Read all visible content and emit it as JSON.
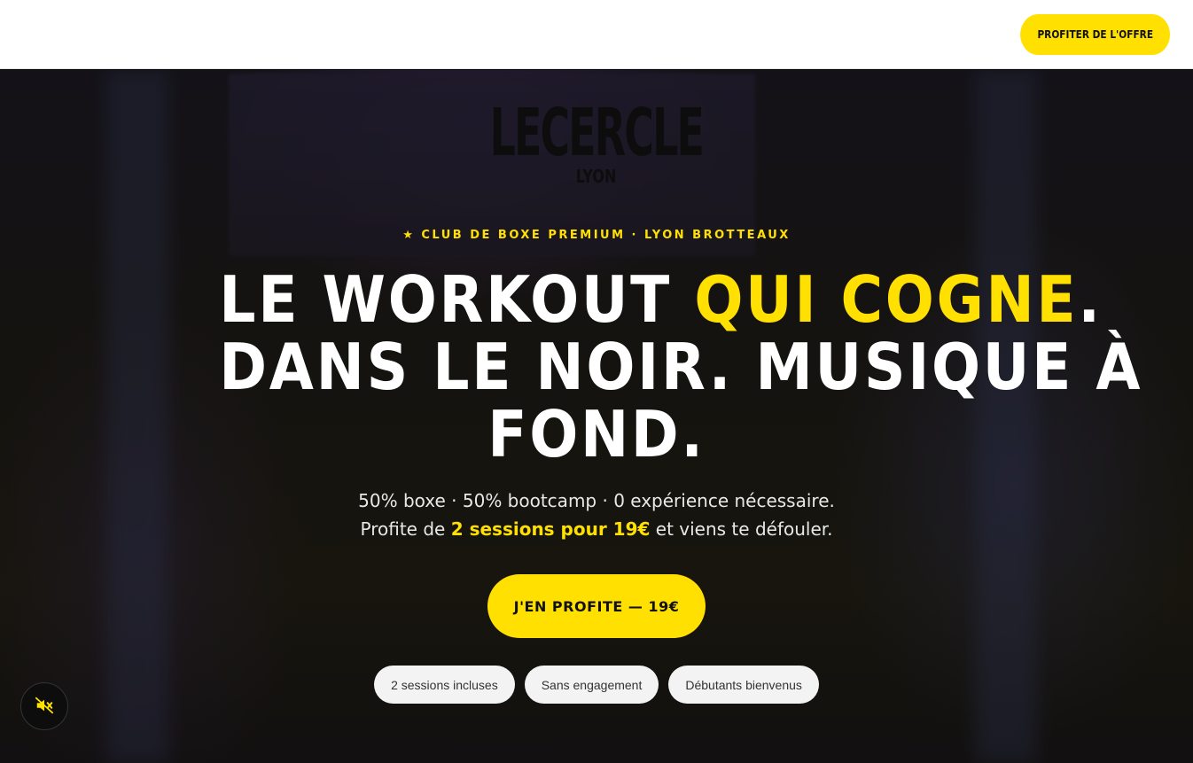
{
  "header": {
    "offer_button": "PROFITER DE L'OFFRE"
  },
  "logo": {
    "word": "LECERCLE",
    "city": "LYON"
  },
  "hero": {
    "tagline": "★ CLUB DE BOXE PREMIUM · LYON BROTTEAUX",
    "headline_part1": "LE WORKOUT ",
    "headline_accent": "QUI COGNE",
    "headline_part2": ".",
    "headline_line2": "DANS LE NOIR. MUSIQUE À",
    "headline_line3": "FOND.",
    "sub_line1": "50% boxe · 50% bootcamp · 0 expérience nécessaire.",
    "sub_line2_pre": "Profite de ",
    "sub_line2_highlight": "2 sessions pour 19€",
    "sub_line2_post": " et viens te défouler.",
    "cta": "J'EN PROFITE — 19€",
    "chips": [
      "2 sessions incluses",
      "Sans engagement",
      "Débutants bienvenus"
    ]
  },
  "controls": {
    "mute_icon": "speaker-muted-icon"
  },
  "colors": {
    "accent": "#ffe000",
    "background": "#0b0b0d",
    "header_bg": "#ffffff"
  }
}
